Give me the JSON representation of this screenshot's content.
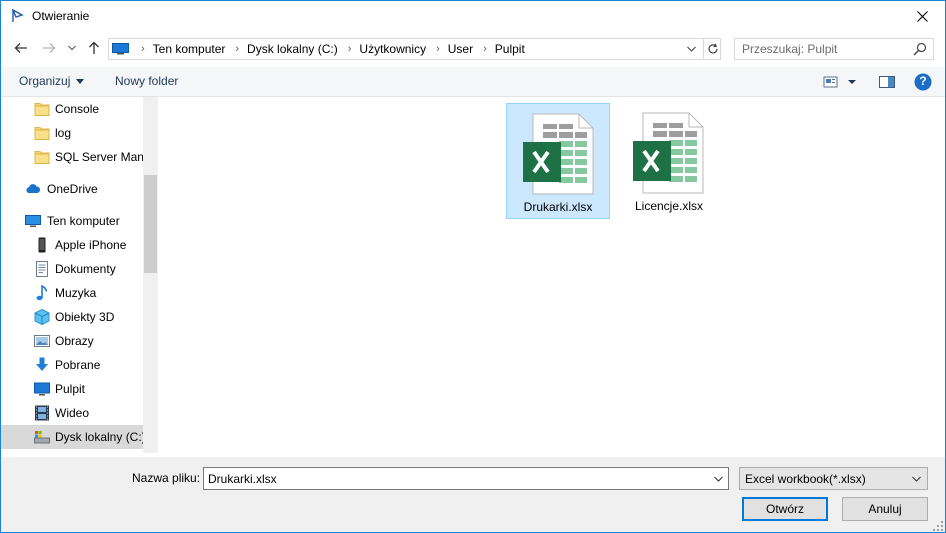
{
  "window": {
    "title": "Otwieranie"
  },
  "address": {
    "crumbs": [
      "Ten komputer",
      "Dysk lokalny (C:)",
      "Użytkownicy",
      "User",
      "Pulpit"
    ]
  },
  "search": {
    "placeholder": "Przeszukaj: Pulpit"
  },
  "toolbar": {
    "organize_label": "Organizuj",
    "new_folder_label": "Nowy folder",
    "help_label": "?"
  },
  "nav": {
    "items": [
      {
        "label": "Console",
        "icon": "folder-icon"
      },
      {
        "label": "log",
        "icon": "folder-icon"
      },
      {
        "label": "SQL Server Mana",
        "icon": "folder-icon"
      },
      {
        "label": "OneDrive",
        "icon": "onedrive-icon"
      },
      {
        "label": "Ten komputer",
        "icon": "computer-icon"
      },
      {
        "label": "Apple iPhone",
        "icon": "phone-icon"
      },
      {
        "label": "Dokumenty",
        "icon": "documents-icon"
      },
      {
        "label": "Muzyka",
        "icon": "music-icon"
      },
      {
        "label": "Obiekty 3D",
        "icon": "objects-3d-icon"
      },
      {
        "label": "Obrazy",
        "icon": "pictures-icon"
      },
      {
        "label": "Pobrane",
        "icon": "downloads-icon"
      },
      {
        "label": "Pulpit",
        "icon": "desktop-icon"
      },
      {
        "label": "Wideo",
        "icon": "video-icon"
      },
      {
        "label": "Dysk lokalny (C:)",
        "icon": "drive-icon"
      }
    ]
  },
  "files": [
    {
      "name": "Drukarki.xlsx",
      "icon": "excel-file-icon",
      "selected": true
    },
    {
      "name": "Licencje.xlsx",
      "icon": "excel-file-icon",
      "selected": false
    }
  ],
  "bottom": {
    "filename_label": "Nazwa pliku:",
    "filename_value": "Drukarki.xlsx",
    "filetype_value": "Excel workbook(*.xlsx)",
    "open_label": "Otwórz",
    "cancel_label": "Anuluj"
  },
  "colors": {
    "accent": "#0078d7",
    "selection": "#cce8ff",
    "excel_green": "#1e7145"
  }
}
